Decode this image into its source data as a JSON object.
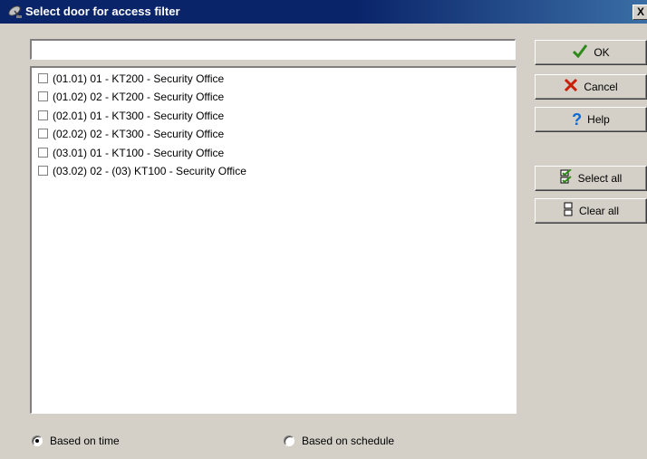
{
  "window": {
    "title": "Select door for access filter",
    "title_icon": "satellite-dish-icon",
    "close_label": "X"
  },
  "filter": {
    "value": "",
    "placeholder": ""
  },
  "doors": [
    {
      "label": "(01.01) 01 - KT200 - Security Office",
      "checked": false
    },
    {
      "label": "(01.02) 02 - KT200 - Security Office",
      "checked": false
    },
    {
      "label": "(02.01) 01 - KT300 - Security Office",
      "checked": false
    },
    {
      "label": "(02.02) 02 - KT300 - Security Office",
      "checked": false
    },
    {
      "label": "(03.01) 01 - KT100 - Security Office",
      "checked": false
    },
    {
      "label": "(03.02) 02 - (03) KT100 - Security Office",
      "checked": false
    }
  ],
  "buttons": {
    "ok": {
      "label": "OK",
      "icon": "check-icon",
      "color": "#2e8b1a"
    },
    "cancel": {
      "label": "Cancel",
      "icon": "x-icon",
      "color": "#c81e0a"
    },
    "help": {
      "label": "Help",
      "icon": "question-icon",
      "color": "#0a6ad4"
    },
    "select_all": {
      "label": "Select all",
      "icon": "select-all-icon"
    },
    "clear_all": {
      "label": "Clear all",
      "icon": "clear-all-icon"
    }
  },
  "mode": {
    "options": [
      {
        "label": "Based on time",
        "selected": true
      },
      {
        "label": "Based on schedule",
        "selected": false
      }
    ]
  }
}
